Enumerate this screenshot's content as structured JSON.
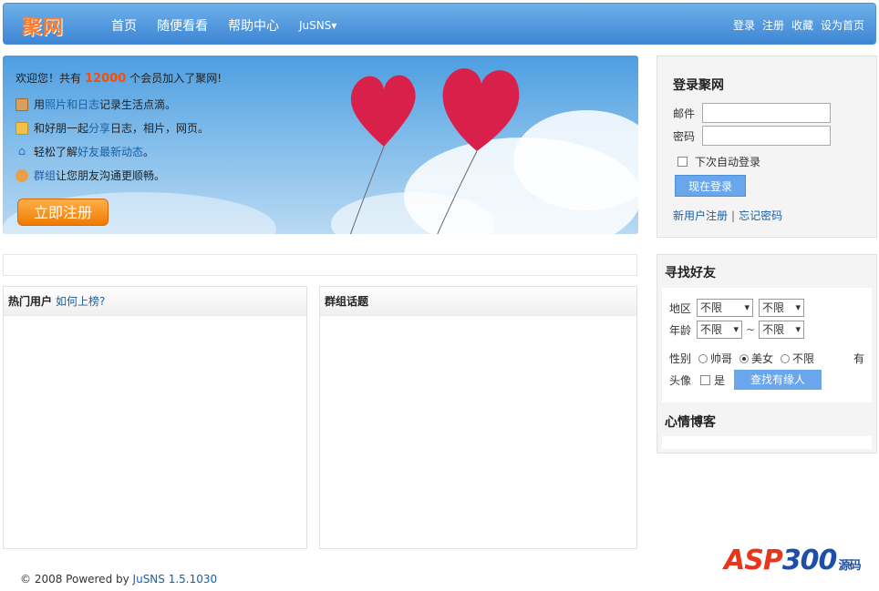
{
  "header": {
    "logo": "聚网",
    "nav": [
      "首页",
      "随便看看",
      "帮助中心",
      "JuSNS▾"
    ],
    "links": [
      "登录",
      "注册",
      "收藏",
      "设为首页"
    ]
  },
  "banner": {
    "welcome_prefix": "欢迎您！共有",
    "member_count": "12000",
    "welcome_suffix": "个会员加入了聚网!",
    "features": [
      {
        "pre": "用",
        "link": "照片和日志",
        "post": "记录生活点滴。"
      },
      {
        "pre": "和好朋一起",
        "link": "分享",
        "post": "日志，相片，网页。"
      },
      {
        "pre": "轻松了解",
        "link": "好友最新动态",
        "post": "。"
      },
      {
        "pre": "",
        "link": "群组",
        "post": "让您朋友沟通更顺畅。"
      }
    ],
    "register_button": "立即注册"
  },
  "login": {
    "title": "登录聚网",
    "email_label": "邮件",
    "password_label": "密码",
    "auto_login": "下次自动登录",
    "submit": "现在登录",
    "register_link": "新用户注册",
    "separator": "|",
    "forgot_link": "忘记密码"
  },
  "panels": {
    "hot_users": "热门用户",
    "how_to_rank": "如何上榜?",
    "group_topics": "群组话题"
  },
  "finder": {
    "title": "寻找好友",
    "region_label": "地区",
    "region1": "不限",
    "region2": "不限",
    "age_label": "年龄",
    "age1": "不限",
    "age_sep": "~",
    "age2": "不限",
    "gender_label": "性别",
    "gender_options": [
      "帅哥",
      "美女",
      "不限"
    ],
    "gender_selected": "美女",
    "avatar_label_a": "有",
    "avatar_label_b": "头像",
    "avatar_yes": "是",
    "search_button": "查找有缘人",
    "mood_title": "心情博客"
  },
  "footer": {
    "copyright": "© 2008 Powered by",
    "product": "JuSNS 1.5.1030"
  },
  "watermark": {
    "text_a": "ASP",
    "text_b": "300",
    "text_c": "源码"
  },
  "colors": {
    "accent_blue": "#3d86d4",
    "link_blue": "#1a5fa8",
    "highlight_orange": "#ff4a00",
    "button_blue": "#6aa6ec"
  }
}
